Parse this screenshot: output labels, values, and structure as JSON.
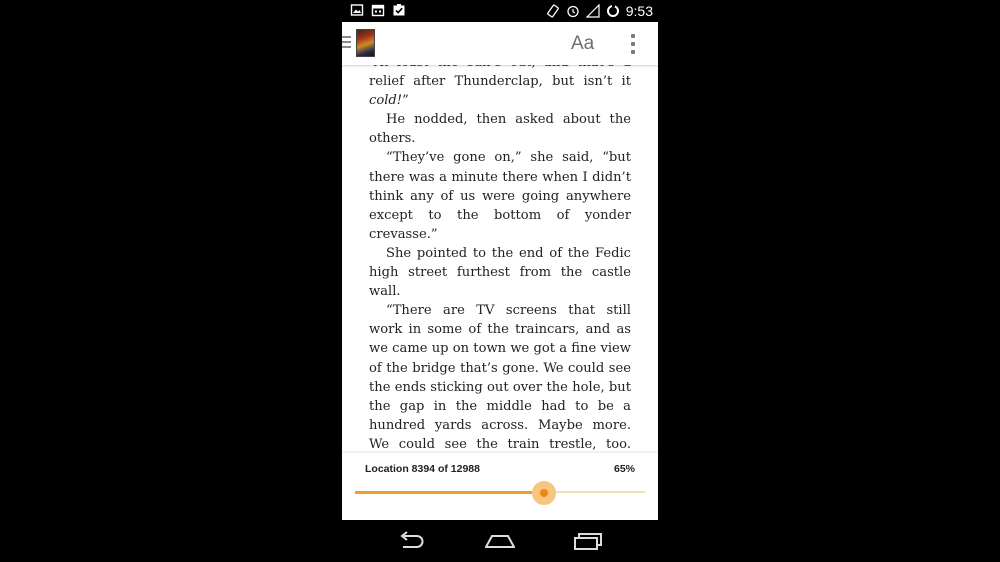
{
  "status_bar": {
    "time": "9:53",
    "left_icons": [
      "image-icon",
      "calendar-icon",
      "task-icon"
    ],
    "right_icons": [
      "rotate-icon",
      "alarm-icon",
      "signal-icon",
      "sync-icon"
    ]
  },
  "toolbar": {
    "font_button_label": "Aa",
    "menu_icon": "hamburger-icon",
    "overflow_icon": "overflow-menu-icon",
    "book_cover_icon": "book-cover-icon"
  },
  "reader": {
    "paragraphs": [
      {
        "text": "“At least the sun’s out, and that’s a relief after Thunderclap, but isn’t it ",
        "emphasis": "cold!",
        "after": "”"
      },
      {
        "text": "He nodded, then asked about the others."
      },
      {
        "text": "“They’ve gone on,” she said, “but there was a minute there when I didn’t think any of us were going anywhere except to the bottom of yonder crevasse.”"
      },
      {
        "text": "She pointed to the end of the Fedic high street furthest from the castle wall."
      },
      {
        "text": "“There are TV screens that still work in some of the traincars, and as we came up on town we got a fine view of the bridge that’s gone. We could see the ends sticking out over the hole, but the gap in the middle had to be a hundred yards across. Maybe more. We could see the train trestle, too. That"
      }
    ]
  },
  "progress": {
    "location_label": "Location 8394 of 12988",
    "percent_label": "65%",
    "fraction": 0.65,
    "accent_color": "#f0a02a",
    "track_color": "#f3dcb4"
  },
  "nav_bar": {
    "back_icon": "back-icon",
    "home_icon": "home-icon",
    "recents_icon": "recent-apps-icon"
  }
}
